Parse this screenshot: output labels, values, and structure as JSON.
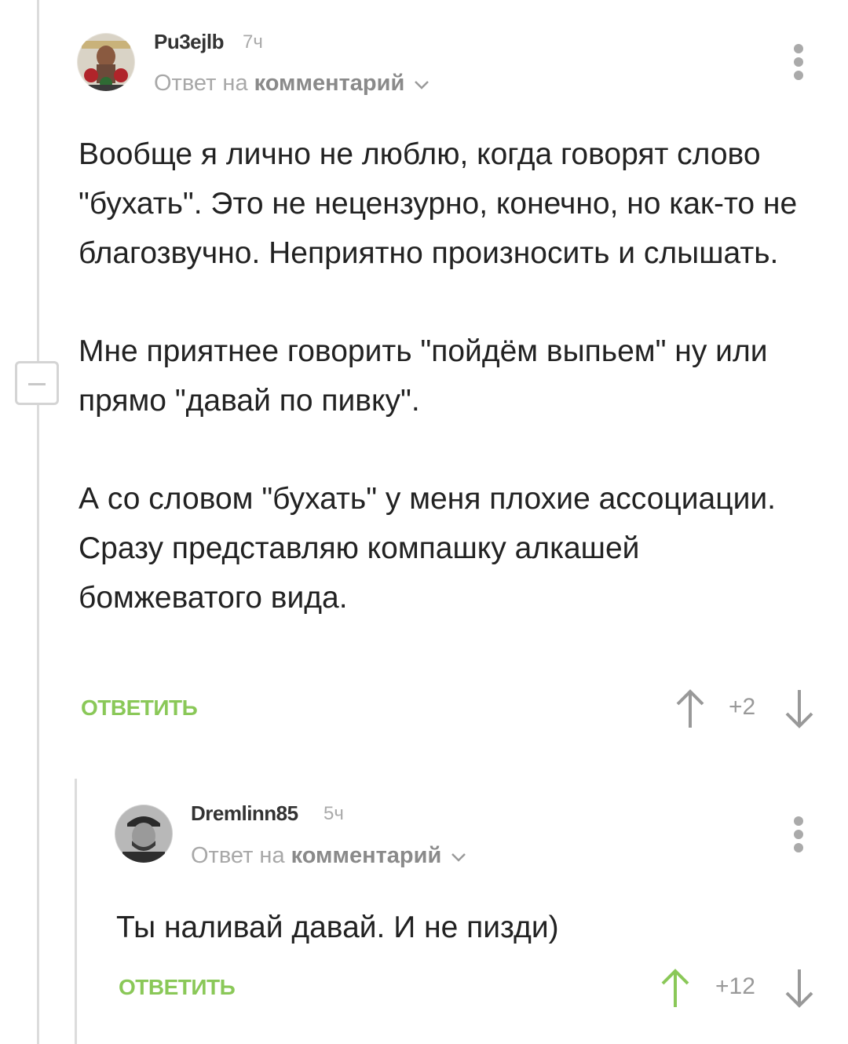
{
  "comments": [
    {
      "author": "Pu3ejlb",
      "time": "7ч",
      "reply_to_label": "Ответ на",
      "reply_to_link": "комментарий",
      "paragraphs": [
        "Вообще я лично не люблю, когда говорят слово \"бухать\". Это не нецензурно, конечно, но как-то не благозвучно. Неприятно произносить и слышать.",
        "Мне приятнее говорить \"пойдём выпьем\" ну или прямо \"давай по пивку\".",
        "А со словом \"бухать\" у меня плохие ассоциации. Сразу представляю компашку алкашей бомжеватого вида."
      ],
      "reply_label": "ОТВЕТИТЬ",
      "rating": "+2",
      "upvoted": false
    },
    {
      "author": "Dremlinn85",
      "time": "5ч",
      "reply_to_label": "Ответ на",
      "reply_to_link": "комментарий",
      "paragraphs": [
        "Ты наливай давай. И не пизди)"
      ],
      "reply_label": "ОТВЕТИТЬ",
      "rating": "+12",
      "upvoted": true
    }
  ],
  "icons": {
    "collapse": "minus-icon",
    "menu": "more-vertical-icon",
    "chevron": "chevron-down-icon",
    "upvote": "arrow-up-icon",
    "downvote": "arrow-down-icon"
  },
  "colors": {
    "accent_green": "#8ac858",
    "neutral_gray": "#999999",
    "thread_line": "#dcdcdc"
  }
}
